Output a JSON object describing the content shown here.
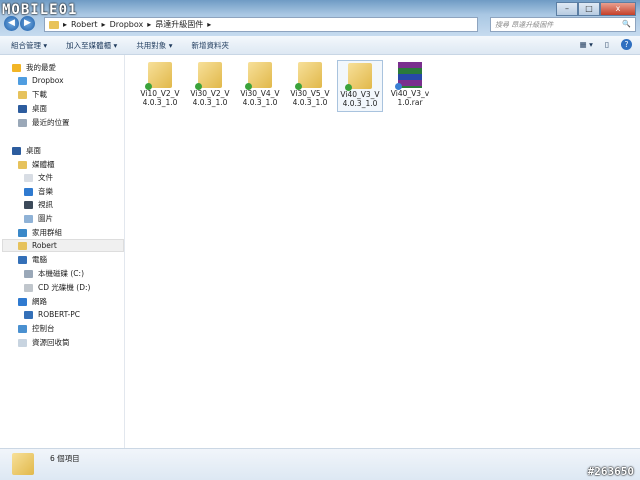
{
  "logo": "MOBILE01",
  "window": {
    "minimize": "–",
    "maximize": "□",
    "close": "x"
  },
  "nav": {
    "back": "◀",
    "forward": "▶"
  },
  "breadcrumb": [
    "Robert",
    "Dropbox",
    "昂達升級固件"
  ],
  "search": {
    "placeholder": "搜尋 昂達升級固件",
    "icon": "🔍"
  },
  "toolbar": {
    "organize": "組合管理 ▾",
    "include": "加入至媒體櫃 ▾",
    "share": "共用對象 ▾",
    "new_folder": "新增資料夾",
    "views": "▦ ▾",
    "preview": "▯",
    "help": "?"
  },
  "sidebar": [
    {
      "label": "我的最愛",
      "color": "#f2b526"
    },
    {
      "label": "Dropbox",
      "color": "#4f9de0"
    },
    {
      "label": "下載",
      "color": "#e6c25c"
    },
    {
      "label": "桌面",
      "color": "#2c5c9e"
    },
    {
      "label": "最近的位置",
      "color": "#9aa8b8"
    },
    {
      "label": "桌面",
      "color": "#2c5c9e"
    },
    {
      "label": "媒體櫃",
      "color": "#e6c25c"
    },
    {
      "label": "文件",
      "color": "#d8dde4"
    },
    {
      "label": "音樂",
      "color": "#2f7ad0"
    },
    {
      "label": "視訊",
      "color": "#3c4a5a"
    },
    {
      "label": "圖片",
      "color": "#8fb2d6"
    },
    {
      "label": "家用群組",
      "color": "#3a88c8"
    },
    {
      "label": "Robert",
      "color": "#e6c25c"
    },
    {
      "label": "電腦",
      "color": "#3470b8"
    },
    {
      "label": "本機磁碟 (C:)",
      "color": "#9aa8b8"
    },
    {
      "label": "CD 光碟機 (D:)",
      "color": "#c0c6cc"
    },
    {
      "label": "網路",
      "color": "#2f7ad0"
    },
    {
      "label": "ROBERT-PC",
      "color": "#3470b8"
    },
    {
      "label": "控制台",
      "color": "#4a90d0"
    },
    {
      "label": "資源回收筒",
      "color": "#c8d4e0"
    }
  ],
  "files": [
    {
      "name": "Vi10_V2_V4.0.3_1.0",
      "type": "folder"
    },
    {
      "name": "Vi30_V2_V4.0.3_1.0",
      "type": "folder"
    },
    {
      "name": "Vi30_V4_V4.0.3_1.0",
      "type": "folder"
    },
    {
      "name": "Vi30_V5_V4.0.3_1.0",
      "type": "folder"
    },
    {
      "name": "Vi40_V3_V4.0.3_1.0",
      "type": "folder",
      "selected": true
    },
    {
      "name": "Vi40_V3_v1.0.rar",
      "type": "rar"
    }
  ],
  "status": {
    "count": "6 個項目"
  },
  "watermark": "#263650"
}
